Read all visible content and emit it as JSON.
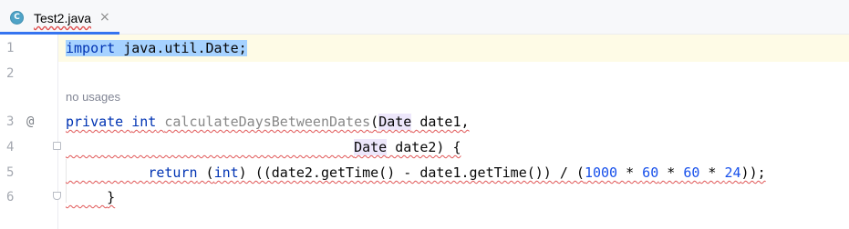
{
  "tab": {
    "icon_letter": "C",
    "title": "Test2.java",
    "close": "×"
  },
  "gutter": {
    "line_numbers": [
      "1",
      "2",
      "3",
      "4",
      "5",
      "6"
    ],
    "override_marker": "@"
  },
  "editor": {
    "inlay_hint": "no usages",
    "line1": {
      "kw": "import",
      "rest": " java.util.Date;"
    },
    "line3": {
      "kw1": "private",
      "kw2": "int",
      "method": "calculateDaysBetweenDates",
      "open_paren": "(",
      "type": "Date",
      "param": " date1,"
    },
    "line4": {
      "type": "Date",
      "param": " date2) {"
    },
    "line5": {
      "kw_return": "return",
      "cast_open": " (",
      "kw_int": "int",
      "expr": ") ((date2.getTime() - date1.getTime()) / (",
      "n1": "1000",
      "op1": " * ",
      "n2": "60",
      "op2": " * ",
      "n3": "60",
      "op3": " * ",
      "n4": "24",
      "end": "));"
    },
    "line6": {
      "brace": "}"
    }
  },
  "colors": {
    "keyword": "#0033b3",
    "number": "#1750eb",
    "selection": "#a6d2ff",
    "error_underline": "#e05555",
    "current_line": "#fefbe6"
  }
}
